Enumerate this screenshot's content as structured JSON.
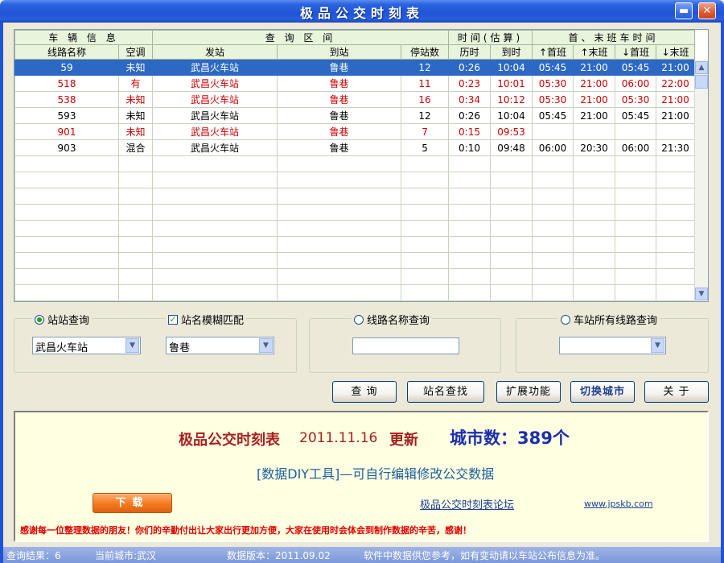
{
  "window": {
    "title": "极品公交时刻表",
    "minimize": "▬",
    "close": "✕"
  },
  "grid": {
    "group_headers": [
      "车 辆 信 息",
      "查 询 区 间",
      "时间(估算)",
      "首、末班车时间"
    ],
    "columns": [
      "线路名称",
      "空调",
      "发站",
      "到站",
      "停站数",
      "历时",
      "到时",
      "↑首班",
      "↑末班",
      "↓首班",
      "↓末班"
    ],
    "rows": [
      [
        "59",
        "未知",
        "武昌火车站",
        "鲁巷",
        "12",
        "0:26",
        "10:04",
        "05:45",
        "21:00",
        "05:45",
        "21:00"
      ],
      [
        "518",
        "有",
        "武昌火车站",
        "鲁巷",
        "11",
        "0:23",
        "10:01",
        "05:30",
        "21:00",
        "06:00",
        "22:00"
      ],
      [
        "538",
        "未知",
        "武昌火车站",
        "鲁巷",
        "16",
        "0:34",
        "10:12",
        "05:30",
        "21:00",
        "05:30",
        "21:00"
      ],
      [
        "593",
        "未知",
        "武昌火车站",
        "鲁巷",
        "12",
        "0:26",
        "10:04",
        "05:45",
        "21:00",
        "05:45",
        "21:00"
      ],
      [
        "901",
        "未知",
        "武昌火车站",
        "鲁巷",
        "7",
        "0:15",
        "09:53",
        "",
        "",
        "",
        ""
      ],
      [
        "903",
        "混合",
        "武昌火车站",
        "鲁巷",
        "5",
        "0:10",
        "09:48",
        "06:00",
        "20:30",
        "06:00",
        "21:30"
      ]
    ],
    "selected_row": 0,
    "red_rows": [
      1,
      2,
      4
    ]
  },
  "query": {
    "station_mode_label": "站站查询",
    "fuzzy_label": "站名模糊匹配",
    "from_station": "武昌火车站",
    "to_station": "鲁巷",
    "line_mode_label": "线路名称查询",
    "line_name_value": "",
    "station_all_label": "车站所有线路查询",
    "station_all_value": ""
  },
  "buttons": {
    "query": "查 询",
    "find_station": "站名查找",
    "extend": "扩展功能",
    "switch_city": "切换城市",
    "about": "关 于"
  },
  "info": {
    "title": "极品公交时刻表",
    "date": "2011.11.16",
    "updated": "更新",
    "city_count": "城市数：389个",
    "diy": "[数据DIY工具]—可自行编辑修改公交数据",
    "download": "下载",
    "forum": "极品公交时刻表论坛",
    "site": "www.jpskb.com",
    "thanks": "感谢每一位整理数据的朋友！你们的辛勤付出让大家出行更加方便，大家在使用时会体会到制作数据的辛苦，感谢！"
  },
  "status": {
    "results": "查询结果：6",
    "city": "当前城市:武汉",
    "version": "数据版本：2011.09.02",
    "note": "软件中数据供您参考，如有变动请以车站公布信息为准。"
  },
  "colors": {
    "selected_row": "#2d68c4",
    "red_text": "#cc0000",
    "title_bar": "#1f54d6"
  }
}
